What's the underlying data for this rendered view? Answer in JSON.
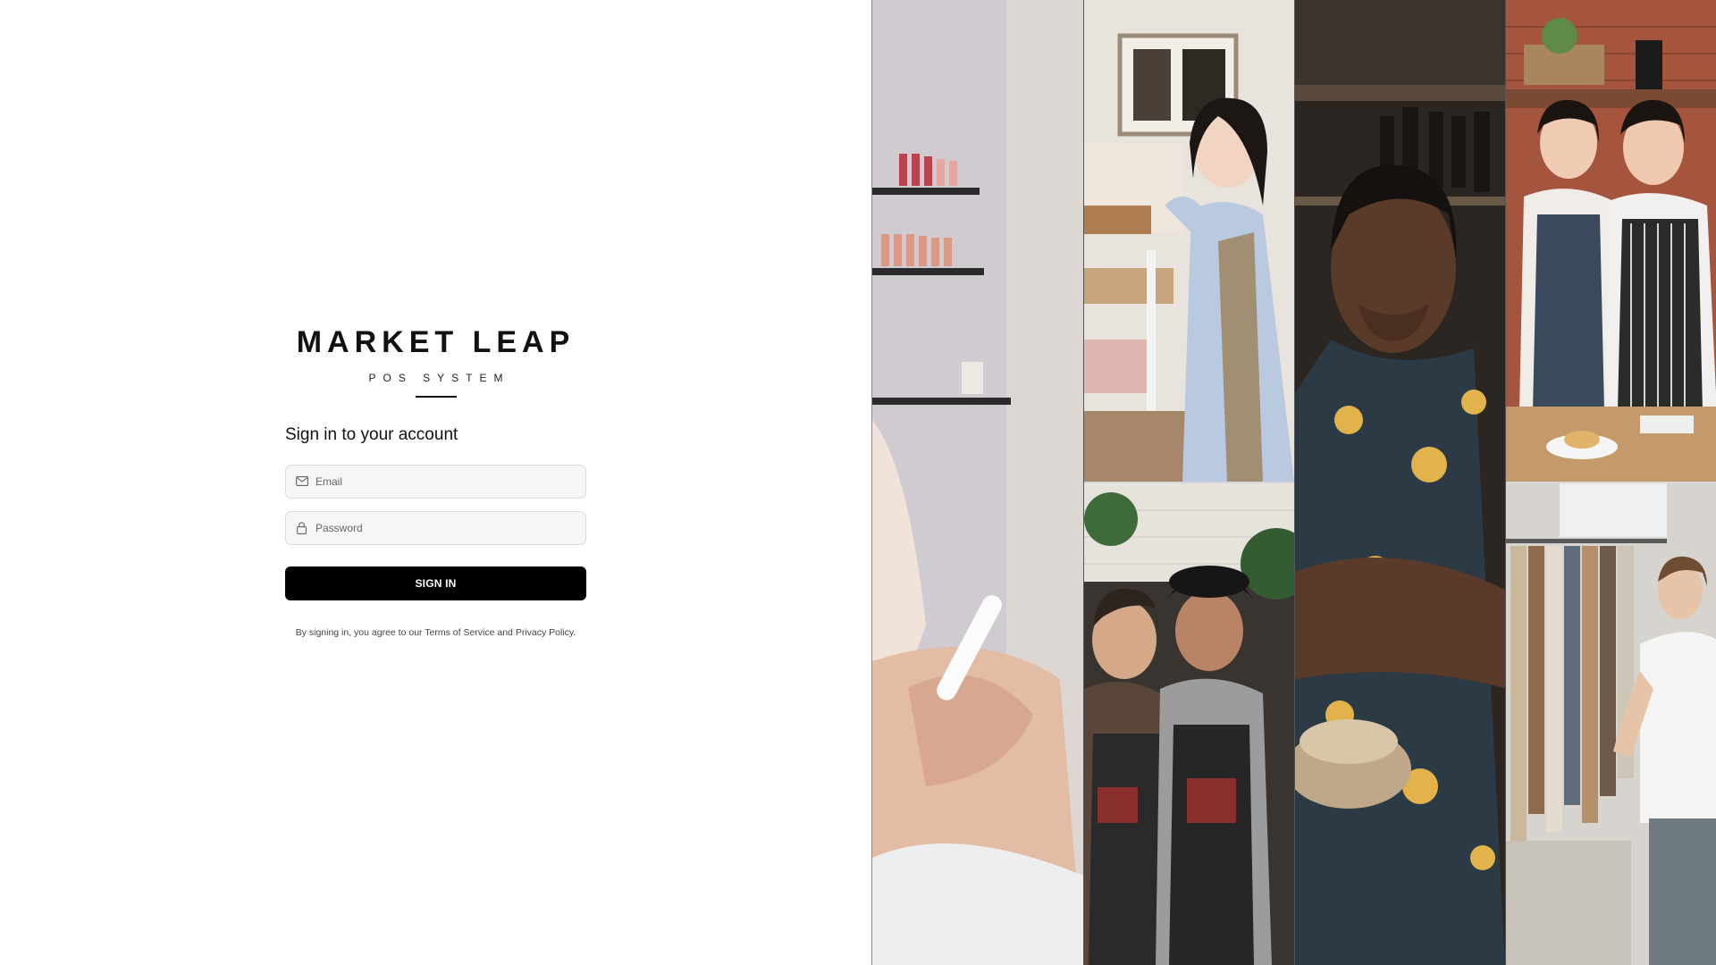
{
  "brand": {
    "title": "MARKET LEAP",
    "subtitle": "POS SYSTEM"
  },
  "login": {
    "heading": "Sign in to your account",
    "email_placeholder": "Email",
    "password_placeholder": "Password",
    "submit_label": "SIGN IN",
    "legal_prefix": "By signing in, you agree to our ",
    "terms_link": "Terms of Service",
    "legal_and": " and ",
    "privacy_link": "Privacy Policy",
    "legal_suffix": "."
  },
  "icons": {
    "email": "mail-icon",
    "password": "lock-icon"
  },
  "colors": {
    "button_bg": "#000000",
    "field_bg": "#f6f6f6",
    "field_border": "#dcdcdc"
  }
}
